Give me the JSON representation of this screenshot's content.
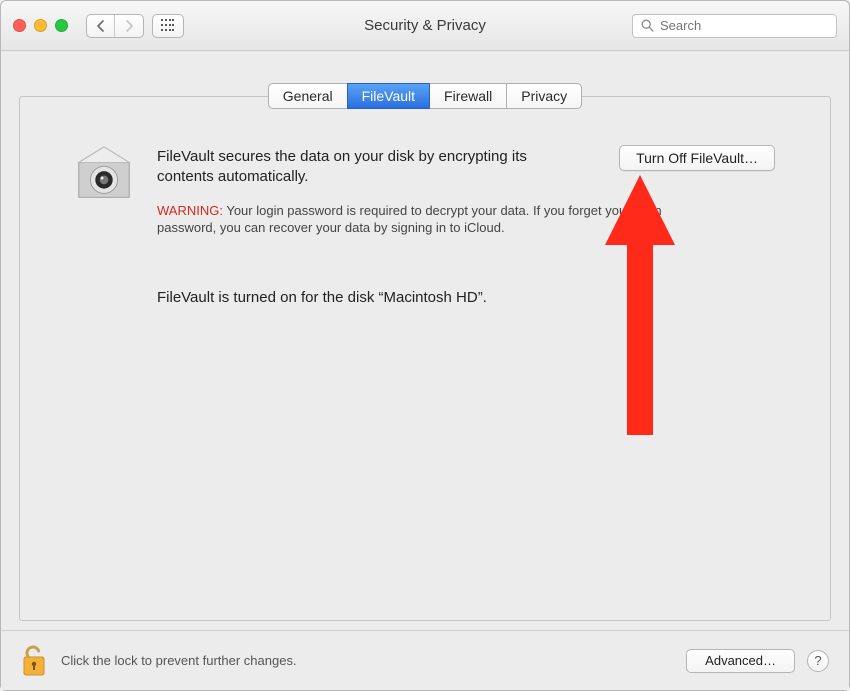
{
  "window": {
    "title": "Security & Privacy",
    "search_placeholder": "Search"
  },
  "tabs": {
    "general": "General",
    "filevault": "FileVault",
    "firewall": "Firewall",
    "privacy": "Privacy"
  },
  "main": {
    "description": "FileVault secures the data on your disk by encrypting its contents automatically.",
    "warning_label": "WARNING:",
    "warning_text": " Your login password is required to decrypt your data. If you forget your login password, you can recover your data by signing in to iCloud.",
    "status": "FileVault is turned on for the disk “Macintosh HD”.",
    "toggle_button": "Turn Off FileVault…"
  },
  "footer": {
    "lock_text": "Click the lock to prevent further changes.",
    "advanced": "Advanced…",
    "help": "?"
  },
  "annotation": {
    "arrow_color": "#ff2a1a"
  }
}
